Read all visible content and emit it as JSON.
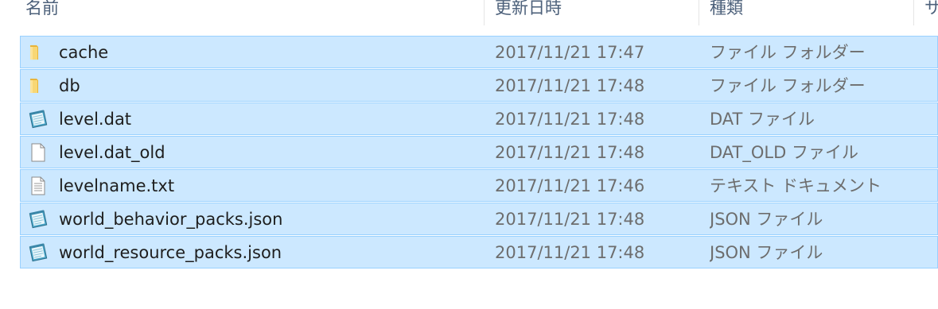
{
  "columns": {
    "name": "名前",
    "date": "更新日時",
    "type": "種類",
    "size": "サ"
  },
  "files": [
    {
      "name": "cache",
      "date": "2017/11/21 17:47",
      "type": "ファイル フォルダー",
      "icon": "folder-icon"
    },
    {
      "name": "db",
      "date": "2017/11/21 17:48",
      "type": "ファイル フォルダー",
      "icon": "folder-icon"
    },
    {
      "name": "level.dat",
      "date": "2017/11/21 17:48",
      "type": "DAT ファイル",
      "icon": "notepad-file-icon"
    },
    {
      "name": "level.dat_old",
      "date": "2017/11/21 17:48",
      "type": "DAT_OLD ファイル",
      "icon": "blank-file-icon"
    },
    {
      "name": "levelname.txt",
      "date": "2017/11/21 17:46",
      "type": "テキスト ドキュメント",
      "icon": "text-file-icon"
    },
    {
      "name": "world_behavior_packs.json",
      "date": "2017/11/21 17:48",
      "type": "JSON ファイル",
      "icon": "notepad-file-icon"
    },
    {
      "name": "world_resource_packs.json",
      "date": "2017/11/21 17:48",
      "type": "JSON ファイル",
      "icon": "notepad-file-icon"
    }
  ],
  "colors": {
    "selection_bg": "#cce8ff",
    "selection_border": "#99d1ff",
    "header_text": "#4c607a",
    "secondary_text": "#6d6d6d"
  }
}
